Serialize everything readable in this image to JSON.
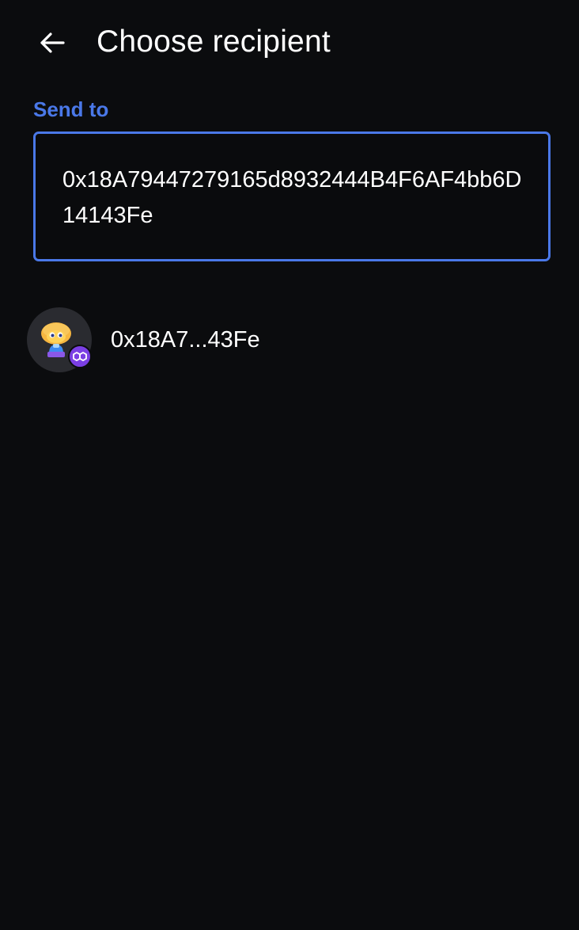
{
  "header": {
    "title": "Choose recipient",
    "back_icon": "arrow-left-icon"
  },
  "form": {
    "label": "Send to",
    "address_value": "0x18A79447279165d8932444B4F6AF4bb6D14143Fe"
  },
  "results": [
    {
      "label": "0x18A7...43Fe",
      "avatar": "emoji-avatar",
      "network_icon": "polygon-icon"
    }
  ],
  "colors": {
    "background": "#0b0c0e",
    "accent": "#4a78e8",
    "network_badge": "#7b3fe4",
    "avatar_bg": "#2a2b30"
  }
}
